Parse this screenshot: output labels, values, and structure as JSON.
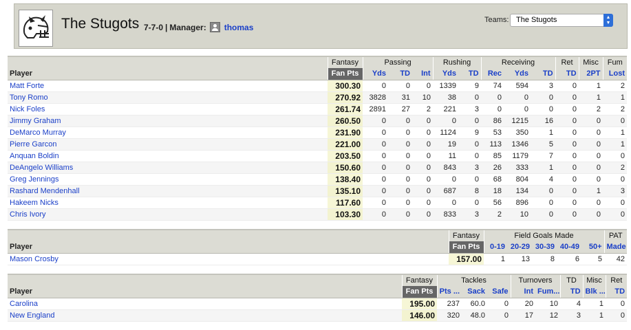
{
  "team": {
    "name": "The Stugots",
    "record": "7-7-0",
    "sep": "|",
    "manager_label": "Manager:",
    "manager": "thomas"
  },
  "teams_select": {
    "label": "Teams:",
    "selected": "The Stugots"
  },
  "offense": {
    "group_headers": [
      "Fantasy",
      "Passing",
      "Rushing",
      "Receiving",
      "Ret",
      "Misc",
      "Fum"
    ],
    "columns": [
      "Player",
      "Fan Pts",
      "Yds",
      "TD",
      "Int",
      "Yds",
      "TD",
      "Rec",
      "Yds",
      "TD",
      "TD",
      "2PT",
      "Lost"
    ],
    "rows": [
      [
        "Matt Forte",
        "300.30",
        "0",
        "0",
        "0",
        "1339",
        "9",
        "74",
        "594",
        "3",
        "0",
        "1",
        "2"
      ],
      [
        "Tony Romo",
        "270.92",
        "3828",
        "31",
        "10",
        "38",
        "0",
        "0",
        "0",
        "0",
        "0",
        "1",
        "1"
      ],
      [
        "Nick Foles",
        "261.74",
        "2891",
        "27",
        "2",
        "221",
        "3",
        "0",
        "0",
        "0",
        "0",
        "2",
        "2"
      ],
      [
        "Jimmy Graham",
        "260.50",
        "0",
        "0",
        "0",
        "0",
        "0",
        "86",
        "1215",
        "16",
        "0",
        "0",
        "0"
      ],
      [
        "DeMarco Murray",
        "231.90",
        "0",
        "0",
        "0",
        "1124",
        "9",
        "53",
        "350",
        "1",
        "0",
        "0",
        "1"
      ],
      [
        "Pierre Garcon",
        "221.00",
        "0",
        "0",
        "0",
        "19",
        "0",
        "113",
        "1346",
        "5",
        "0",
        "0",
        "1"
      ],
      [
        "Anquan Boldin",
        "203.50",
        "0",
        "0",
        "0",
        "11",
        "0",
        "85",
        "1179",
        "7",
        "0",
        "0",
        "0"
      ],
      [
        "DeAngelo Williams",
        "150.60",
        "0",
        "0",
        "0",
        "843",
        "3",
        "26",
        "333",
        "1",
        "0",
        "0",
        "2"
      ],
      [
        "Greg Jennings",
        "138.40",
        "0",
        "0",
        "0",
        "0",
        "0",
        "68",
        "804",
        "4",
        "0",
        "0",
        "0"
      ],
      [
        "Rashard Mendenhall",
        "135.10",
        "0",
        "0",
        "0",
        "687",
        "8",
        "18",
        "134",
        "0",
        "0",
        "1",
        "3"
      ],
      [
        "Hakeem Nicks",
        "117.60",
        "0",
        "0",
        "0",
        "0",
        "0",
        "56",
        "896",
        "0",
        "0",
        "0",
        "0"
      ],
      [
        "Chris Ivory",
        "103.30",
        "0",
        "0",
        "0",
        "833",
        "3",
        "2",
        "10",
        "0",
        "0",
        "0",
        "0"
      ]
    ]
  },
  "kicker": {
    "group_headers": [
      "Fantasy",
      "Field Goals Made",
      "PAT"
    ],
    "columns": [
      "Player",
      "Fan Pts",
      "0-19",
      "20-29",
      "30-39",
      "40-49",
      "50+",
      "Made"
    ],
    "rows": [
      [
        "Mason Crosby",
        "157.00",
        "1",
        "13",
        "8",
        "6",
        "5",
        "42"
      ]
    ]
  },
  "defense": {
    "group_headers": [
      "Fantasy",
      "Tackles",
      "Turnovers",
      "TD",
      "Misc",
      "Ret"
    ],
    "columns": [
      "Player",
      "Fan Pts",
      "Pts ...",
      "Sack",
      "Safe",
      "Int",
      "Fum...",
      "TD",
      "Blk ...",
      "TD"
    ],
    "rows": [
      [
        "Carolina",
        "195.00",
        "237",
        "60.0",
        "0",
        "20",
        "10",
        "4",
        "1",
        "0"
      ],
      [
        "New England",
        "146.00",
        "320",
        "48.0",
        "0",
        "17",
        "12",
        "3",
        "1",
        "0"
      ]
    ]
  }
}
